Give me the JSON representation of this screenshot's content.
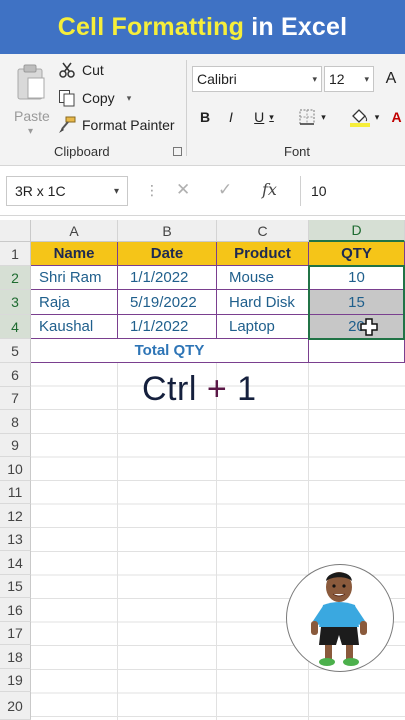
{
  "banner": {
    "title_part1": "Cell Formatting",
    "title_part2": " in Excel"
  },
  "ribbon": {
    "clipboard": {
      "paste_label": "Paste",
      "cut_label": "Cut",
      "copy_label": "Copy",
      "format_painter_label": "Format Painter",
      "group_label": "Clipboard"
    },
    "font": {
      "font_name": "Calibri",
      "font_size": "12",
      "bold": "B",
      "italic": "I",
      "underline": "U",
      "group_label": "Font"
    }
  },
  "formula_bar": {
    "name_box": "3R x 1C",
    "separator": "⋮",
    "cancel_glyph": "✕",
    "enter_glyph": "✓",
    "fx_label": "fx",
    "value": "10"
  },
  "sheet": {
    "columns": [
      "A",
      "B",
      "C",
      "D"
    ],
    "rows": [
      "1",
      "2",
      "3",
      "4",
      "5",
      "6",
      "7",
      "8",
      "9",
      "10",
      "11",
      "12",
      "13",
      "14",
      "15",
      "16",
      "17",
      "18",
      "19",
      "20"
    ],
    "headers": [
      "Name",
      "Date",
      "Product",
      "QTY"
    ],
    "data": [
      [
        "Shri Ram",
        "1/1/2022",
        "Mouse",
        "10"
      ],
      [
        "Raja",
        "5/19/2022",
        "Hard Disk",
        "15"
      ],
      [
        "Kaushal",
        "1/1/2022",
        "Laptop",
        "20"
      ]
    ],
    "total_label": "Total QTY",
    "selected_column": "D",
    "selected_rows": [
      "2",
      "3",
      "4"
    ]
  },
  "overlay": {
    "shortcut_main": "Ctrl ",
    "shortcut_plus": "+",
    "shortcut_key": " 1"
  },
  "colors": {
    "banner_bg": "#3f72c4",
    "banner_highlight": "#f6ee3a",
    "header_fill": "#f5c518",
    "selection_green": "#217346",
    "table_border": "#7a3f8f"
  }
}
